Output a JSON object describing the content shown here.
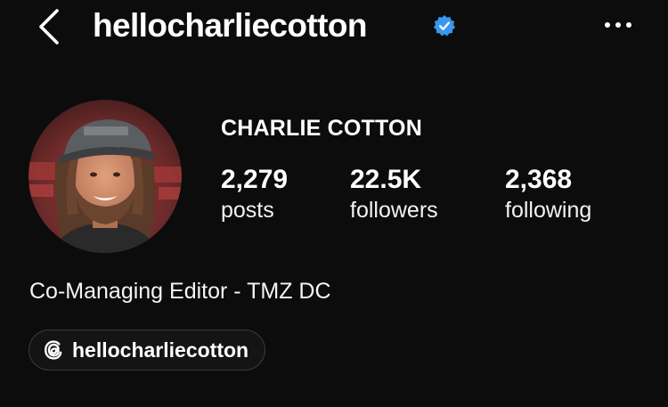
{
  "header": {
    "username": "hellocharliecotton",
    "verified": true,
    "back_icon": "chevron-left-icon",
    "more_icon": "more-horizontal-icon"
  },
  "profile": {
    "display_name": "CHARLIE COTTON",
    "avatar_alt": "profile-photo",
    "stats": {
      "posts": {
        "value": "2,279",
        "label": "posts"
      },
      "followers": {
        "value": "22.5K",
        "label": "followers"
      },
      "following": {
        "value": "2,368",
        "label": "following"
      }
    },
    "bio": "Co-Managing Editor - TMZ DC",
    "threads_link": {
      "icon": "threads-icon",
      "label": "hellocharliecotton"
    }
  },
  "colors": {
    "background": "#0c0c0c",
    "text": "#ffffff",
    "verified_badge": "#3897f0",
    "pill_border": "#3a3a3a"
  }
}
